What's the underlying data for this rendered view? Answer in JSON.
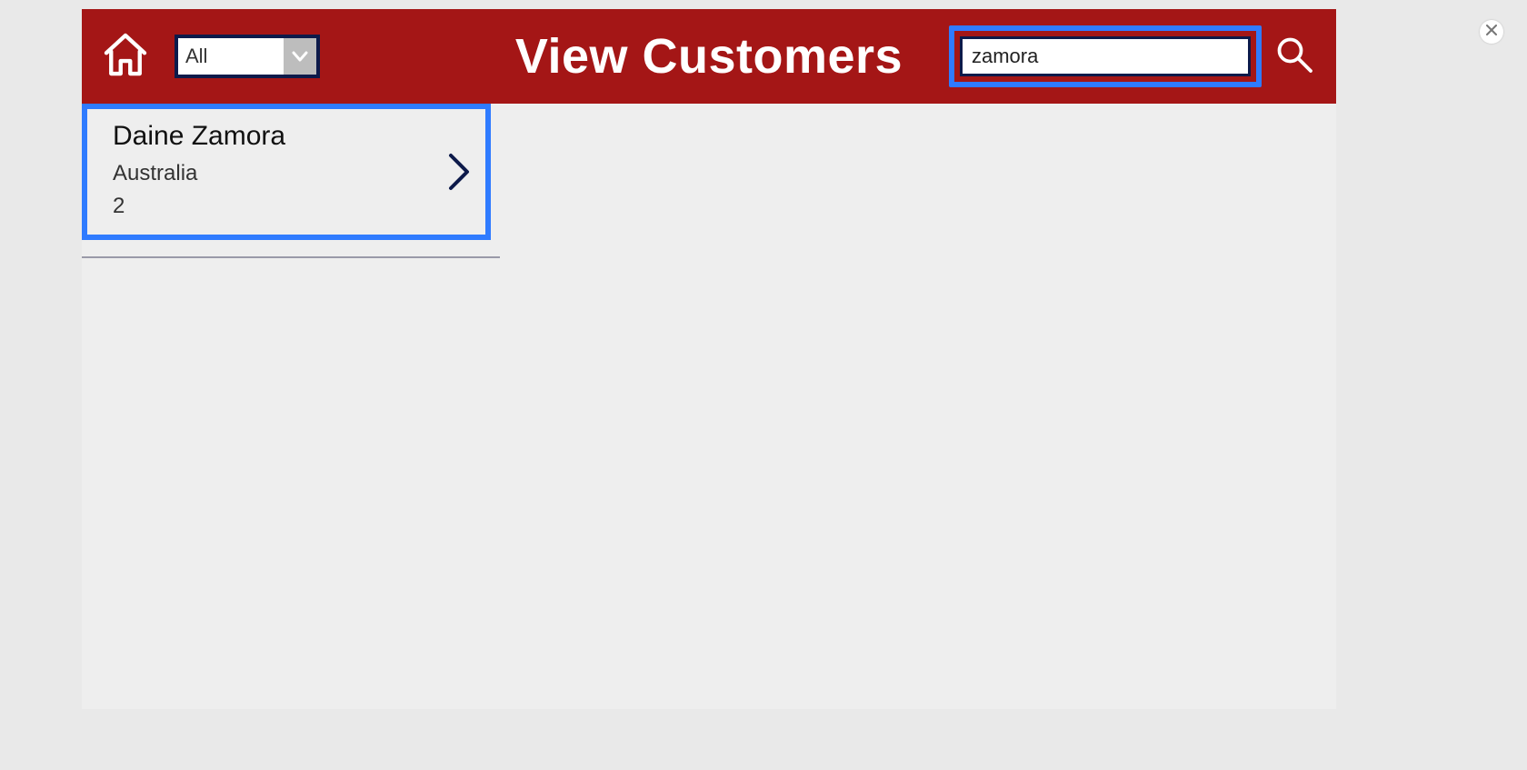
{
  "header": {
    "title": "View Customers",
    "filter_selected": "All",
    "search_value": "zamora"
  },
  "results": [
    {
      "name": "Daine  Zamora",
      "country": "Australia",
      "count": "2"
    }
  ],
  "colors": {
    "bar": "#a41616",
    "highlight": "#2f7bff",
    "navy": "#0d1a4a"
  }
}
